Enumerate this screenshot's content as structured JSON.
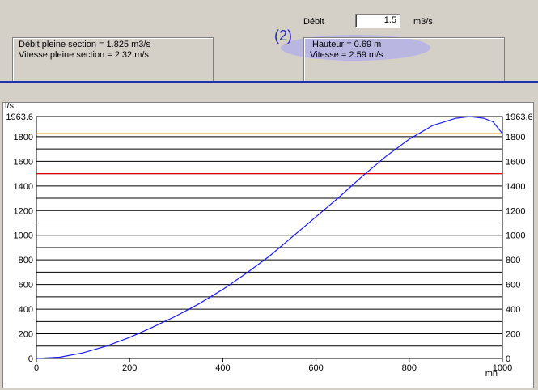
{
  "header": {
    "debit_label": "Débit",
    "debit_value": "1.5",
    "debit_unit": "m3/s"
  },
  "left_box": {
    "line1": "Débit pleine section = 1.825 m3/s",
    "line2": "Vitesse pleine section = 2.32 m/s"
  },
  "right_box": {
    "marker": "(2)",
    "line1": "Hauteur  = 0.69 m",
    "line2": "Vitesse = 2.59 m/s"
  },
  "colors": {
    "curve": "#1a1aff",
    "orange_line": "#e0a000",
    "red_line": "#e00000",
    "separator": "#1737a8",
    "highlight": "#b9b7e2"
  },
  "chart_data": {
    "type": "line",
    "ylabel": "l/s",
    "xlabel": "mn",
    "xlim": [
      0,
      1000
    ],
    "ylim": [
      0,
      1963.6
    ],
    "x_ticks": [
      "0",
      "200",
      "400",
      "600",
      "800",
      "1000"
    ],
    "y_ticks": [
      "0",
      "200",
      "400",
      "600",
      "800",
      "1000",
      "1200",
      "1400",
      "1600",
      "1800",
      "1963.6"
    ],
    "grid": true,
    "hlines": [
      {
        "value": 1825,
        "color": "#e0a000"
      },
      {
        "value": 1500,
        "color": "#e00000"
      }
    ],
    "series": [
      {
        "values_x": [
          0,
          50,
          100,
          150,
          200,
          250,
          300,
          350,
          400,
          450,
          500,
          550,
          600,
          650,
          700,
          750,
          800,
          850,
          900,
          930,
          960,
          980,
          1000
        ],
        "values_y": [
          0,
          10,
          45,
          100,
          170,
          255,
          345,
          445,
          560,
          690,
          830,
          990,
          1150,
          1310,
          1480,
          1640,
          1780,
          1890,
          1950,
          1963.6,
          1950,
          1920,
          1825
        ]
      }
    ]
  }
}
